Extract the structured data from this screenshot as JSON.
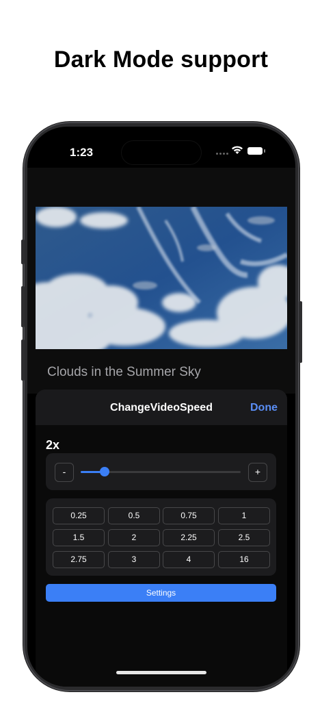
{
  "headline": "Dark Mode support",
  "status_bar": {
    "time": "1:23"
  },
  "video": {
    "title": "Clouds in the Summer Sky"
  },
  "sheet": {
    "title": "ChangeVideoSpeed",
    "done_label": "Done"
  },
  "speed": {
    "label": "2x",
    "decrement_label": "-",
    "increment_label": "+",
    "slider_fraction": 0.15
  },
  "presets": [
    [
      "0.25",
      "0.5",
      "0.75",
      "1"
    ],
    [
      "1.5",
      "2",
      "2.25",
      "2.5"
    ],
    [
      "2.75",
      "3",
      "4",
      "16"
    ]
  ],
  "settings_label": "Settings",
  "colors": {
    "accent": "#3b7ff6",
    "done_text": "#5a8ef5",
    "panel_bg": "#1c1c1e"
  }
}
